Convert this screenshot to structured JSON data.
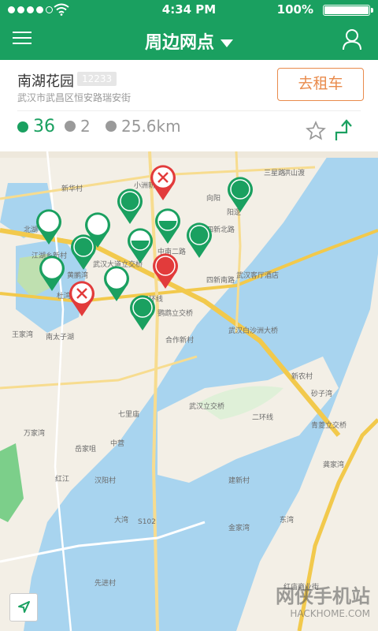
{
  "status": {
    "time": "4:34 PM",
    "battery": "100%"
  },
  "header": {
    "title": "周边网点"
  },
  "station": {
    "name": "南湖花园",
    "id": "12233",
    "address": "武汉市武昌区恒安路瑞安街",
    "rent_label": "去租车",
    "bikes": "36",
    "parking": "2",
    "distance": "25.6km"
  },
  "map": {
    "labels": [
      "北湖",
      "新华村",
      "江湖乡新村",
      "黄鹂湾",
      "杜湾",
      "小洲新村",
      "向阳",
      "阳逻",
      "中南二路",
      "四新北路",
      "四新南路",
      "武汉大道立交桥",
      "三星路",
      "南太子湖",
      "武汉客厅酒店",
      "王家湾",
      "鹦鹉立交桥",
      "合作新村",
      "武汉白沙洲大桥",
      "七里庙",
      "万家湾",
      "岳家咀",
      "中营",
      "红江",
      "汉阳村",
      "大湾",
      "建新村",
      "金家湾",
      "东湾",
      "红庙商业街",
      "青菱立交桥",
      "龚家湾",
      "武汉立交桥",
      "新农村",
      "砂子湾",
      "洪山渡",
      "先进村",
      "三环线",
      "二环线",
      "S102"
    ],
    "watermark_cn": "网侠手机站",
    "watermark_en": "HACKHOME.COM"
  },
  "icons": {
    "menu": "menu-icon",
    "caret": "caret-down-icon",
    "user": "user-icon",
    "bike": "bike-icon",
    "parking": "parking-icon",
    "distance": "distance-icon",
    "star": "star-icon",
    "route": "route-icon",
    "locate": "locate-icon"
  },
  "colors": {
    "brand": "#1aa060",
    "accent": "#e98b4c",
    "pin_red": "#e23b3b"
  }
}
